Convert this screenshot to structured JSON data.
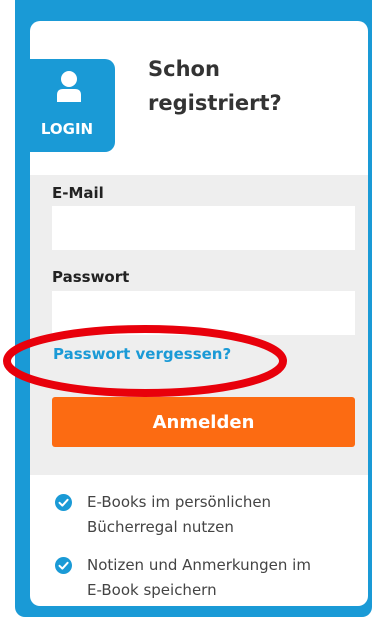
{
  "login_tab": {
    "label": "LOGIN",
    "icon": "user-icon"
  },
  "heading": {
    "line1": "Schon",
    "line2": "registriert?"
  },
  "form": {
    "email_label": "E-Mail",
    "email_value": "",
    "password_label": "Passwort",
    "password_value": "",
    "forgot_link": "Passwort vergessen?",
    "submit_label": "Anmelden"
  },
  "benefits": [
    {
      "line1": "E-Books im persönlichen",
      "line2": "Bücherregal nutzen",
      "icon": "check-circle-icon"
    },
    {
      "line1": "Notizen und Anmerkungen im",
      "line2": "E-Book speichern",
      "icon": "check-circle-icon"
    }
  ],
  "colors": {
    "accent_blue": "#1a9ad6",
    "button_orange": "#fc6b12",
    "highlight_red": "#e8000b",
    "form_bg": "#eeeeee"
  }
}
